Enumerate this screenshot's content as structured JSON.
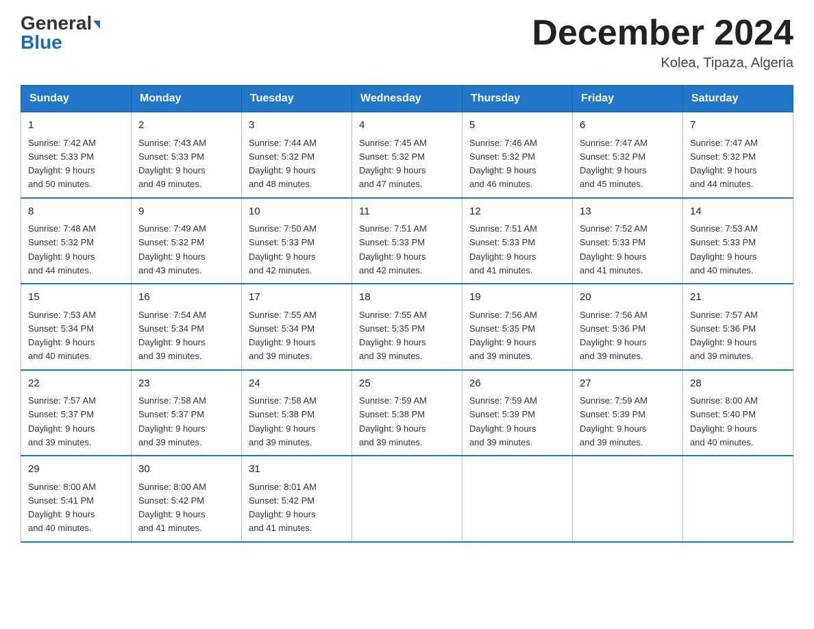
{
  "header": {
    "logo_part1": "General",
    "logo_part2": "Blue",
    "month_title": "December 2024",
    "location": "Kolea, Tipaza, Algeria"
  },
  "days_of_week": [
    "Sunday",
    "Monday",
    "Tuesday",
    "Wednesday",
    "Thursday",
    "Friday",
    "Saturday"
  ],
  "weeks": [
    [
      {
        "day": "1",
        "sunrise": "7:42 AM",
        "sunset": "5:33 PM",
        "daylight": "9 hours and 50 minutes."
      },
      {
        "day": "2",
        "sunrise": "7:43 AM",
        "sunset": "5:33 PM",
        "daylight": "9 hours and 49 minutes."
      },
      {
        "day": "3",
        "sunrise": "7:44 AM",
        "sunset": "5:32 PM",
        "daylight": "9 hours and 48 minutes."
      },
      {
        "day": "4",
        "sunrise": "7:45 AM",
        "sunset": "5:32 PM",
        "daylight": "9 hours and 47 minutes."
      },
      {
        "day": "5",
        "sunrise": "7:46 AM",
        "sunset": "5:32 PM",
        "daylight": "9 hours and 46 minutes."
      },
      {
        "day": "6",
        "sunrise": "7:47 AM",
        "sunset": "5:32 PM",
        "daylight": "9 hours and 45 minutes."
      },
      {
        "day": "7",
        "sunrise": "7:47 AM",
        "sunset": "5:32 PM",
        "daylight": "9 hours and 44 minutes."
      }
    ],
    [
      {
        "day": "8",
        "sunrise": "7:48 AM",
        "sunset": "5:32 PM",
        "daylight": "9 hours and 44 minutes."
      },
      {
        "day": "9",
        "sunrise": "7:49 AM",
        "sunset": "5:32 PM",
        "daylight": "9 hours and 43 minutes."
      },
      {
        "day": "10",
        "sunrise": "7:50 AM",
        "sunset": "5:33 PM",
        "daylight": "9 hours and 42 minutes."
      },
      {
        "day": "11",
        "sunrise": "7:51 AM",
        "sunset": "5:33 PM",
        "daylight": "9 hours and 42 minutes."
      },
      {
        "day": "12",
        "sunrise": "7:51 AM",
        "sunset": "5:33 PM",
        "daylight": "9 hours and 41 minutes."
      },
      {
        "day": "13",
        "sunrise": "7:52 AM",
        "sunset": "5:33 PM",
        "daylight": "9 hours and 41 minutes."
      },
      {
        "day": "14",
        "sunrise": "7:53 AM",
        "sunset": "5:33 PM",
        "daylight": "9 hours and 40 minutes."
      }
    ],
    [
      {
        "day": "15",
        "sunrise": "7:53 AM",
        "sunset": "5:34 PM",
        "daylight": "9 hours and 40 minutes."
      },
      {
        "day": "16",
        "sunrise": "7:54 AM",
        "sunset": "5:34 PM",
        "daylight": "9 hours and 39 minutes."
      },
      {
        "day": "17",
        "sunrise": "7:55 AM",
        "sunset": "5:34 PM",
        "daylight": "9 hours and 39 minutes."
      },
      {
        "day": "18",
        "sunrise": "7:55 AM",
        "sunset": "5:35 PM",
        "daylight": "9 hours and 39 minutes."
      },
      {
        "day": "19",
        "sunrise": "7:56 AM",
        "sunset": "5:35 PM",
        "daylight": "9 hours and 39 minutes."
      },
      {
        "day": "20",
        "sunrise": "7:56 AM",
        "sunset": "5:36 PM",
        "daylight": "9 hours and 39 minutes."
      },
      {
        "day": "21",
        "sunrise": "7:57 AM",
        "sunset": "5:36 PM",
        "daylight": "9 hours and 39 minutes."
      }
    ],
    [
      {
        "day": "22",
        "sunrise": "7:57 AM",
        "sunset": "5:37 PM",
        "daylight": "9 hours and 39 minutes."
      },
      {
        "day": "23",
        "sunrise": "7:58 AM",
        "sunset": "5:37 PM",
        "daylight": "9 hours and 39 minutes."
      },
      {
        "day": "24",
        "sunrise": "7:58 AM",
        "sunset": "5:38 PM",
        "daylight": "9 hours and 39 minutes."
      },
      {
        "day": "25",
        "sunrise": "7:59 AM",
        "sunset": "5:38 PM",
        "daylight": "9 hours and 39 minutes."
      },
      {
        "day": "26",
        "sunrise": "7:59 AM",
        "sunset": "5:39 PM",
        "daylight": "9 hours and 39 minutes."
      },
      {
        "day": "27",
        "sunrise": "7:59 AM",
        "sunset": "5:39 PM",
        "daylight": "9 hours and 39 minutes."
      },
      {
        "day": "28",
        "sunrise": "8:00 AM",
        "sunset": "5:40 PM",
        "daylight": "9 hours and 40 minutes."
      }
    ],
    [
      {
        "day": "29",
        "sunrise": "8:00 AM",
        "sunset": "5:41 PM",
        "daylight": "9 hours and 40 minutes."
      },
      {
        "day": "30",
        "sunrise": "8:00 AM",
        "sunset": "5:42 PM",
        "daylight": "9 hours and 41 minutes."
      },
      {
        "day": "31",
        "sunrise": "8:01 AM",
        "sunset": "5:42 PM",
        "daylight": "9 hours and 41 minutes."
      },
      null,
      null,
      null,
      null
    ]
  ],
  "labels": {
    "sunrise": "Sunrise:",
    "sunset": "Sunset:",
    "daylight": "Daylight:"
  }
}
